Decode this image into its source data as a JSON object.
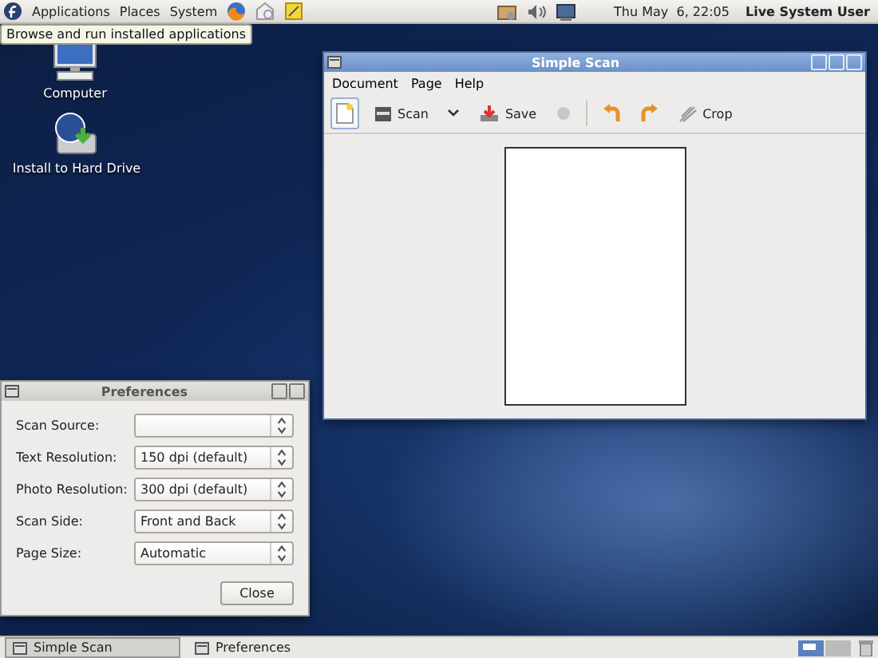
{
  "top_panel": {
    "menus": [
      "Applications",
      "Places",
      "System"
    ],
    "clock": "Thu May  6, 22:05",
    "user": "Live System User"
  },
  "tooltip": "Browse and run installed applications",
  "desktop_icons": [
    {
      "kind": "computer",
      "label": "Computer"
    },
    {
      "kind": "install",
      "label": "Install to Hard Drive"
    }
  ],
  "scan_window": {
    "title": "Simple Scan",
    "active": true,
    "menus": [
      "Document",
      "Page",
      "Help"
    ],
    "toolbar": [
      {
        "kind": "new",
        "highlighted": true
      },
      {
        "kind": "scan",
        "label": "Scan",
        "highlighted": false
      },
      {
        "kind": "dropdown",
        "highlighted": false
      },
      {
        "kind": "save",
        "label": "Save",
        "highlighted": false
      },
      {
        "kind": "stop",
        "highlighted": false
      },
      {
        "kind": "separator"
      },
      {
        "kind": "rotate_left",
        "highlighted": false
      },
      {
        "kind": "rotate_right",
        "highlighted": false
      },
      {
        "kind": "crop",
        "label": "Crop",
        "highlighted": false
      }
    ]
  },
  "preferences": {
    "title": "Preferences",
    "active": false,
    "fields": [
      {
        "label": "Scan Source:"
      },
      {
        "label": "Text Resolution:",
        "value": "150 dpi (default)"
      },
      {
        "label": "Photo Resolution:",
        "value": "300 dpi (default)"
      },
      {
        "label": "Scan Side:",
        "value": "Front and Back"
      },
      {
        "label": "Page Size:",
        "value": "Automatic"
      }
    ],
    "close": "Close"
  },
  "taskbar": [
    {
      "label": "Simple Scan",
      "selected": true
    },
    {
      "label": "Preferences",
      "selected": false
    }
  ]
}
